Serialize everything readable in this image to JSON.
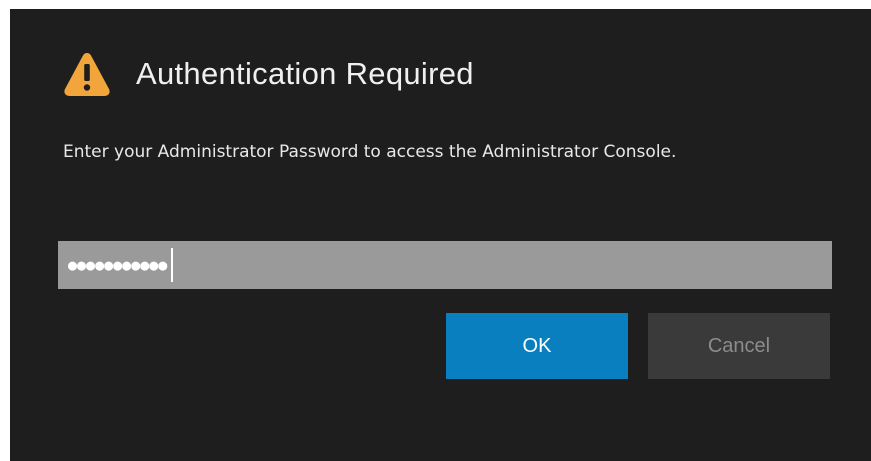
{
  "dialog": {
    "icon": "warning-triangle-icon",
    "title": "Authentication Required",
    "message": "Enter your Administrator Password to access the Administrator Console.",
    "password": {
      "masked_value": "●●●●●●●●●●●",
      "placeholder": ""
    },
    "buttons": {
      "ok_label": "OK",
      "cancel_label": "Cancel"
    }
  },
  "colors": {
    "background": "#1e1e1f",
    "accent": "#0a7fc0",
    "warning": "#f2a53a",
    "field": "#9a9a9a",
    "cancel_bg": "#3a3a3b"
  }
}
